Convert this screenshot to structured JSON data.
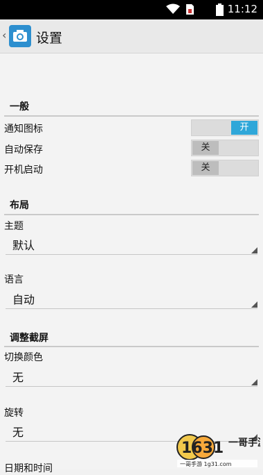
{
  "status_bar": {
    "time": "11:12"
  },
  "header": {
    "title": "设置",
    "back_glyph": "‹"
  },
  "sections": {
    "general": {
      "title": "一般",
      "rows": [
        {
          "label": "通知图标",
          "toggle": "开",
          "state": "on"
        },
        {
          "label": "自动保存",
          "toggle": "关",
          "state": "off"
        },
        {
          "label": "开机启动",
          "toggle": "关",
          "state": "off"
        }
      ]
    },
    "layout": {
      "title": "布局",
      "theme_label": "主题",
      "theme_value": "默认",
      "language_label": "语言",
      "language_value": "自动"
    },
    "screenshot": {
      "title": "调整截屏",
      "switch_color_label": "切换颜色",
      "switch_color_value": "无",
      "rotate_label": "旋转",
      "rotate_value": "无",
      "date_time_label": "日期和时间"
    }
  },
  "watermark": {
    "logo_text": "1631",
    "brand": "一哥手游",
    "url": "一哥手游 1g31.com"
  },
  "colors": {
    "toggle_on": "#2fa7d9",
    "app_icon": "#2d8fcf"
  }
}
